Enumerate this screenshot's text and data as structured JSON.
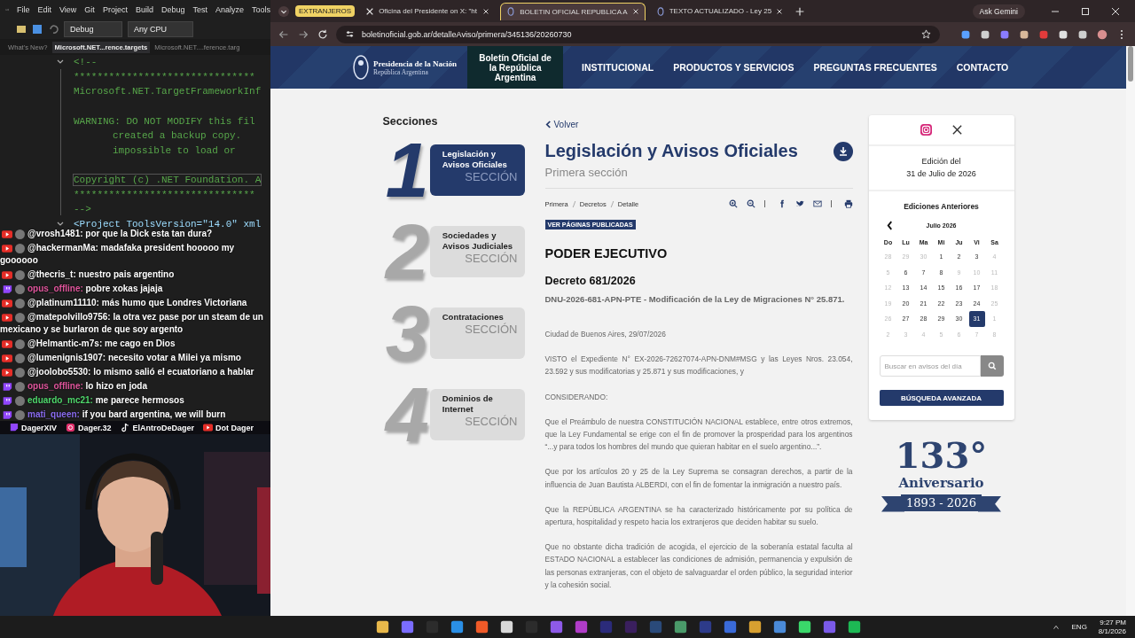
{
  "vs": {
    "menu": [
      "File",
      "Edit",
      "View",
      "Git",
      "Project",
      "Build",
      "Debug",
      "Test",
      "Analyze",
      "Tools"
    ],
    "config": "Debug",
    "platform": "Any CPU",
    "doc_tabs": [
      {
        "label": "What's New?",
        "selected": false
      },
      {
        "label": "Microsoft.NET...rence.targets",
        "selected": true
      },
      {
        "label": "Microsoft.NET....ference.targ",
        "selected": false
      }
    ],
    "code": [
      {
        "kind": "comment",
        "text": "<!--",
        "fold": true,
        "indented": false,
        "highlighted": false
      },
      {
        "kind": "comment",
        "text": "*******************************",
        "fold": false,
        "indented": false,
        "highlighted": false
      },
      {
        "kind": "comment",
        "text": "Microsoft.NET.TargetFrameworkInf",
        "fold": false,
        "indented": false,
        "highlighted": false
      },
      {
        "kind": "blank"
      },
      {
        "kind": "comment",
        "text": "WARNING:  DO NOT MODIFY this fil",
        "fold": false,
        "indented": false,
        "highlighted": false
      },
      {
        "kind": "comment",
        "text": "created a backup copy.",
        "fold": false,
        "indented": true,
        "highlighted": false
      },
      {
        "kind": "comment",
        "text": "impossible to load or",
        "fold": false,
        "indented": true,
        "highlighted": false
      },
      {
        "kind": "blank"
      },
      {
        "kind": "comment",
        "text": "Copyright (c) .NET Foundation. A",
        "fold": false,
        "indented": false,
        "highlighted": true
      },
      {
        "kind": "comment",
        "text": "*******************************",
        "fold": false,
        "indented": false,
        "highlighted": false
      },
      {
        "kind": "comment",
        "text": "-->",
        "fold": false,
        "indented": false,
        "highlighted": false
      },
      {
        "kind": "tag",
        "text": "<Project ToolsVersion=\"14.0\" xml",
        "fold": true,
        "indented": false,
        "highlighted": false
      },
      {
        "kind": "blank"
      }
    ]
  },
  "chat": [
    {
      "kind": "youtube",
      "user": "@vrosh1481:",
      "color": "#ffffff",
      "text": "por que la Dick esta tan dura?"
    },
    {
      "kind": "youtube",
      "user": "@hackermanMa:",
      "color": "#ffffff",
      "text": "madafaka president hooooo my goooooo"
    },
    {
      "kind": "youtube",
      "user": "@thecris_t:",
      "color": "#ffffff",
      "text": "nuestro pais argentino"
    },
    {
      "kind": "twitch",
      "user": "opus_offline:",
      "color": "#e0559c",
      "text": "pobre xokas jajaja"
    },
    {
      "kind": "youtube",
      "user": "@platinum11110:",
      "color": "#ffffff",
      "text": "más humo que Londres Victoriana"
    },
    {
      "kind": "youtube",
      "user": "@matepolvillo9756:",
      "color": "#ffffff",
      "text": "la otra vez pase por un steam de un mexicano y se burlaron de que soy argento"
    },
    {
      "kind": "youtube",
      "user": "@Helmantic-m7s:",
      "color": "#ffffff",
      "text": "me cago en Dios"
    },
    {
      "kind": "youtube",
      "user": "@lumenignis1907:",
      "color": "#ffffff",
      "text": "necesito votar a Milei ya mismo"
    },
    {
      "kind": "youtube",
      "user": "@joolobo5530:",
      "color": "#ffffff",
      "text": "lo mismo salió el ecuatoriano a hablar"
    },
    {
      "kind": "twitch",
      "user": "opus_offline:",
      "color": "#e0559c",
      "text": "lo hizo en joda"
    },
    {
      "kind": "twitch",
      "user": "eduardo_mc21:",
      "color": "#4fd66b",
      "text": "me parece hermosos"
    },
    {
      "kind": "twitch",
      "user": "mati_queen:",
      "color": "#8a6cf0",
      "text": "if you bard argentina, we will burn"
    }
  ],
  "socials": [
    {
      "kind": "twitch",
      "handle": "DagerXIV"
    },
    {
      "kind": "instagram",
      "handle": "Dager.32"
    },
    {
      "kind": "tiktok",
      "handle": "ElAntroDeDager"
    },
    {
      "kind": "youtube",
      "handle": "Dot Dager"
    }
  ],
  "browser": {
    "group": "EXTRANJEROS",
    "tabs": [
      {
        "title": "Oficina del Presidente on X: \"ht",
        "kind": "x",
        "selected": false
      },
      {
        "title": "BOLETIN OFICIAL REPUBLICA A",
        "kind": "site",
        "selected": true
      },
      {
        "title": "TEXTO ACTUALIZADO - Ley 25",
        "kind": "site",
        "selected": false
      }
    ],
    "gemini": "Ask Gemini",
    "url": "boletinoficial.gob.ar/detalleAviso/primera/345136/20260730"
  },
  "site": {
    "logo": [
      "Presidencia de la Nación",
      "República Argentina"
    ],
    "nav": [
      {
        "label": "Boletín Oficial de la República Argentina",
        "selected": true
      },
      {
        "label": "INSTITUCIONAL",
        "selected": false
      },
      {
        "label": "PRODUCTOS Y SERVICIOS",
        "selected": false
      },
      {
        "label": "PREGUNTAS FRECUENTES",
        "selected": false
      },
      {
        "label": "CONTACTO",
        "selected": false
      }
    ],
    "sections_title": "Secciones",
    "sections": [
      {
        "number": "1",
        "lines": [
          "Legislación y",
          "Avisos Oficiales"
        ],
        "label": "SECCIÓN",
        "selected": true
      },
      {
        "number": "2",
        "lines": [
          "Sociedades y",
          "Avisos Judiciales"
        ],
        "label": "SECCIÓN",
        "selected": false
      },
      {
        "number": "3",
        "lines": [
          "Contrataciones"
        ],
        "label": "SECCIÓN",
        "selected": false
      },
      {
        "number": "4",
        "lines": [
          "Dominios de",
          "Internet"
        ],
        "label": "SECCIÓN",
        "selected": false
      }
    ],
    "back": "Volver",
    "title": "Legislación y Avisos Oficiales",
    "subtitle": "Primera sección",
    "breadcrumbs": [
      "Primera",
      "Decretos",
      "Detalle"
    ],
    "badge": "VER PÁGINAS PUBLICADAS",
    "branch": "PODER EJECUTIVO",
    "decree": "Decreto 681/2026",
    "summary": "DNU-2026-681-APN-PTE - Modificación de la Ley de Migraciones N° 25.871.",
    "paragraphs": [
      "Ciudad de Buenos Aires, 29/07/2026",
      "VISTO el Expediente N° EX-2026-72627074-APN-DNM#MSG y las Leyes Nros. 23.054, 23.592 y sus modificatorias y 25.871 y sus modificaciones, y",
      "CONSIDERANDO:",
      "Que el Preámbulo de nuestra CONSTITUCIÓN NACIONAL establece, entre otros extremos, que la Ley Fundamental se erige con el fin de promover la prosperidad para los argentinos “...y para todos los hombres del mundo que quieran habitar en el suelo argentino...”.",
      "Que por los artículos 20 y 25 de la Ley Suprema se consagran derechos, a partir de la influencia de Juan Bautista ALBERDI, con el fin de fomentar la inmigración a nuestro país.",
      "Que la REPÚBLICA ARGENTINA se ha caracterizado históricamente por su política de apertura, hospitalidad y respeto hacia los extranjeros que deciden habitar su suelo.",
      "Que no obstante dicha tradición de acogida, el ejercicio de la soberanía estatal faculta al ESTADO NACIONAL a establecer las condiciones de admisión, permanencia y expulsión de las personas extranjeras, con el objeto de salvaguardar el orden público, la seguridad interior y la cohesión social."
    ],
    "edition": [
      "Edición del",
      "31 de Julio de 2026"
    ],
    "previous": "Ediciones Anteriores",
    "month": "Julio 2026",
    "weekdays": [
      "Do",
      "Lu",
      "Ma",
      "Mi",
      "Ju",
      "Vi",
      "Sa"
    ],
    "days": [
      {
        "d": "28",
        "muted": true,
        "selected": false
      },
      {
        "d": "29",
        "muted": true,
        "selected": false
      },
      {
        "d": "30",
        "muted": true,
        "selected": false
      },
      {
        "d": "1",
        "muted": false,
        "selected": false
      },
      {
        "d": "2",
        "muted": false,
        "selected": false
      },
      {
        "d": "3",
        "muted": false,
        "selected": false
      },
      {
        "d": "4",
        "muted": true,
        "selected": false
      },
      {
        "d": "5",
        "muted": true,
        "selected": false
      },
      {
        "d": "6",
        "muted": false,
        "selected": false
      },
      {
        "d": "7",
        "muted": false,
        "selected": false
      },
      {
        "d": "8",
        "muted": false,
        "selected": false
      },
      {
        "d": "9",
        "muted": true,
        "selected": false
      },
      {
        "d": "10",
        "muted": true,
        "selected": false
      },
      {
        "d": "11",
        "muted": true,
        "selected": false
      },
      {
        "d": "12",
        "muted": true,
        "selected": false
      },
      {
        "d": "13",
        "muted": false,
        "selected": false
      },
      {
        "d": "14",
        "muted": false,
        "selected": false
      },
      {
        "d": "15",
        "muted": false,
        "selected": false
      },
      {
        "d": "16",
        "muted": false,
        "selected": false
      },
      {
        "d": "17",
        "muted": false,
        "selected": false
      },
      {
        "d": "18",
        "muted": true,
        "selected": false
      },
      {
        "d": "19",
        "muted": true,
        "selected": false
      },
      {
        "d": "20",
        "muted": false,
        "selected": false
      },
      {
        "d": "21",
        "muted": false,
        "selected": false
      },
      {
        "d": "22",
        "muted": false,
        "selected": false
      },
      {
        "d": "23",
        "muted": false,
        "selected": false
      },
      {
        "d": "24",
        "muted": false,
        "selected": false
      },
      {
        "d": "25",
        "muted": true,
        "selected": false
      },
      {
        "d": "26",
        "muted": true,
        "selected": false
      },
      {
        "d": "27",
        "muted": false,
        "selected": false
      },
      {
        "d": "28",
        "muted": false,
        "selected": false
      },
      {
        "d": "29",
        "muted": false,
        "selected": false
      },
      {
        "d": "30",
        "muted": false,
        "selected": false
      },
      {
        "d": "31",
        "muted": false,
        "selected": true
      },
      {
        "d": "1",
        "muted": true,
        "selected": false
      },
      {
        "d": "2",
        "muted": true,
        "selected": false
      },
      {
        "d": "3",
        "muted": true,
        "selected": false
      },
      {
        "d": "4",
        "muted": true,
        "selected": false
      },
      {
        "d": "5",
        "muted": true,
        "selected": false
      },
      {
        "d": "6",
        "muted": true,
        "selected": false
      },
      {
        "d": "7",
        "muted": true,
        "selected": false
      },
      {
        "d": "8",
        "muted": true,
        "selected": false
      }
    ],
    "search": {
      "placeholder": "Buscar en avisos del día"
    },
    "advanced": "BÚSQUEDA AVANZADA",
    "anniversary": {
      "number": "133°",
      "label": "Aniversario",
      "years": "1893 - 2026"
    }
  },
  "taskbar": {
    "language": "ENG",
    "time": "9:27 PM",
    "date": "8/1/2026"
  }
}
